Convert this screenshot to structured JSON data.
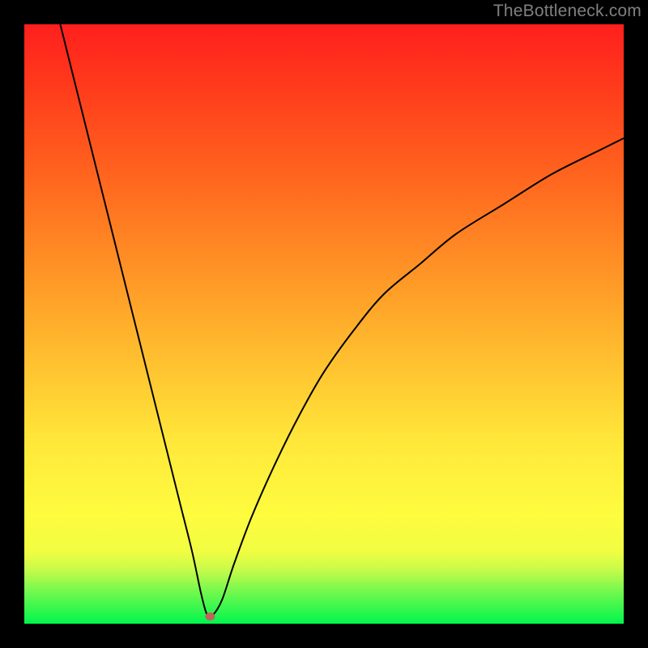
{
  "watermark": "TheBottleneck.com",
  "chart_data": {
    "type": "line",
    "title": "",
    "xlabel": "",
    "ylabel": "",
    "xlim": [
      0,
      100
    ],
    "ylim": [
      0,
      100
    ],
    "grid": false,
    "legend": false,
    "axes_visible": false,
    "background": "vertical-spectrum-gradient (green→yellow→orange→red)",
    "gradient_stops": [
      {
        "pos": 0.0,
        "color": "#00f64c"
      },
      {
        "pos": 0.05,
        "color": "#6bf84e"
      },
      {
        "pos": 0.09,
        "color": "#c6fb4a"
      },
      {
        "pos": 0.12,
        "color": "#f1fd42"
      },
      {
        "pos": 0.18,
        "color": "#fefc3f"
      },
      {
        "pos": 0.3,
        "color": "#ffe83a"
      },
      {
        "pos": 0.45,
        "color": "#ffbd2f"
      },
      {
        "pos": 0.6,
        "color": "#ff9025"
      },
      {
        "pos": 0.75,
        "color": "#ff641e"
      },
      {
        "pos": 0.88,
        "color": "#ff3f1c"
      },
      {
        "pos": 1.0,
        "color": "#ff1f1d"
      }
    ],
    "series": [
      {
        "name": "bottleneck-curve",
        "x": [
          6,
          8,
          10,
          12,
          14,
          16,
          18,
          20,
          22,
          24,
          26,
          28,
          29.5,
          30.5,
          31.5,
          33,
          35,
          38,
          42,
          46,
          50,
          55,
          60,
          66,
          72,
          80,
          88,
          96,
          100
        ],
        "y": [
          100,
          92,
          84,
          76,
          68,
          60,
          52,
          44,
          36,
          28,
          20,
          12,
          5,
          1.5,
          1.5,
          4,
          10,
          18,
          27,
          35,
          42,
          49,
          55,
          60,
          65,
          70,
          75,
          79,
          81
        ]
      }
    ],
    "marker": {
      "x": 31.0,
      "y": 1.2,
      "color": "#c0635d",
      "rx": 6,
      "ry": 5
    },
    "notes": "V-shaped curve: steep linear descent from top-left to a minimum near x≈31, then concave-down rise toward upper-right. Values are visual estimates (no axis ticks shown)."
  }
}
